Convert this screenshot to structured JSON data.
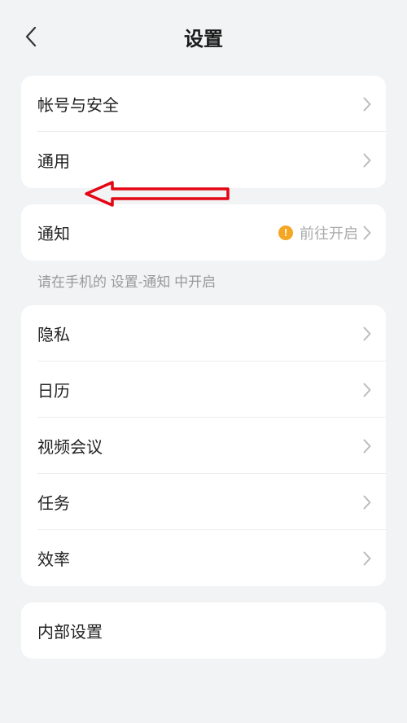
{
  "header": {
    "title": "设置"
  },
  "group1": {
    "items": [
      {
        "label": "帐号与安全"
      },
      {
        "label": "通用"
      }
    ]
  },
  "group2": {
    "items": [
      {
        "label": "通知",
        "hint": "前往开启",
        "warning": true
      }
    ],
    "footerHint": "请在手机的 设置-通知 中开启"
  },
  "group3": {
    "items": [
      {
        "label": "隐私"
      },
      {
        "label": "日历"
      },
      {
        "label": "视频会议"
      },
      {
        "label": "任务"
      },
      {
        "label": "效率"
      }
    ]
  },
  "group4": {
    "items": [
      {
        "label": "内部设置"
      }
    ]
  },
  "annotation": {
    "arrowColor": "#e30613"
  }
}
